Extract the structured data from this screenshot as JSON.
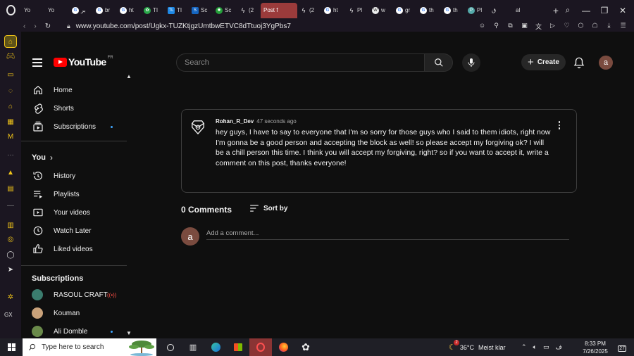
{
  "browser": {
    "tabs": [
      {
        "label": "Yo",
        "icon": "youtube-icon"
      },
      {
        "label": "Yo",
        "icon": "youtube-icon"
      },
      {
        "label": "بر",
        "icon": "google-icon"
      },
      {
        "label": "br",
        "icon": "google-icon"
      },
      {
        "label": "ht",
        "icon": "google-icon"
      },
      {
        "label": "TI",
        "icon": "openai-icon"
      },
      {
        "label": "TI",
        "icon": "tl-icon"
      },
      {
        "label": "Sc",
        "icon": "s-icon"
      },
      {
        "label": "Sc",
        "icon": "gear-icon"
      },
      {
        "label": "(2",
        "icon": "lightning-icon"
      },
      {
        "label": "Post f",
        "icon": "youtube-icon",
        "active": true
      },
      {
        "label": "(2",
        "icon": "lightning-icon"
      },
      {
        "label": "ht",
        "icon": "google-icon"
      },
      {
        "label": "Pl",
        "icon": "lightning-icon"
      },
      {
        "label": "w",
        "icon": "wiki-icon"
      },
      {
        "label": "gr",
        "icon": "google-icon"
      },
      {
        "label": "th",
        "icon": "google-icon"
      },
      {
        "label": "th",
        "icon": "google-icon"
      },
      {
        "label": "Pl",
        "icon": "pl-icon"
      },
      {
        "label": "ق",
        "icon": "youtube-icon"
      },
      {
        "label": "al",
        "icon": "youtube-icon"
      }
    ],
    "url": "www.youtube.com/post/Ugkx-TUZKtjgzUmtbwETVC8dTtuoj3YgPbs7"
  },
  "header": {
    "logo_text": "YouTube",
    "country_code": "FR",
    "search_placeholder": "Search",
    "create_label": "Create",
    "avatar_letter": "a"
  },
  "guide": {
    "main": [
      {
        "label": "Home",
        "icon": "home-icon"
      },
      {
        "label": "Shorts",
        "icon": "shorts-icon"
      },
      {
        "label": "Subscriptions",
        "icon": "subscriptions-icon",
        "dot": true
      }
    ],
    "you_heading": "You",
    "you": [
      {
        "label": "History",
        "icon": "history-icon"
      },
      {
        "label": "Playlists",
        "icon": "playlists-icon"
      },
      {
        "label": "Your videos",
        "icon": "your-videos-icon"
      },
      {
        "label": "Watch Later",
        "icon": "clock-icon"
      },
      {
        "label": "Liked videos",
        "icon": "thumbs-up-icon"
      }
    ],
    "subscriptions_heading": "Subscriptions",
    "subscriptions": [
      {
        "label": "RASOUL CRAFT",
        "live": true,
        "color": "#3b7d6e"
      },
      {
        "label": "Kouman",
        "live": false,
        "color": "#c9a27a"
      },
      {
        "label": "Ali Domble",
        "live": false,
        "color": "#6a8a4a",
        "dot": true
      }
    ]
  },
  "post": {
    "author": "Rohan_R_Dev",
    "time": "47 seconds ago",
    "text": "hey guys, I have to say to everyone that I'm so sorry for those guys who I said to them idiots, right now I'm gonna be a good person and accepting the block as well! so please accept my forgiving ok? I will be a chill person this time. I think you will accept my forgiving, right? so if you want to accept it, write a comment on this post, thanks everyone!"
  },
  "comments": {
    "count_label": "0 Comments",
    "sort_label": "Sort by",
    "add_placeholder": "Add a comment...",
    "avatar_letter": "a"
  },
  "taskbar": {
    "search_placeholder": "Type here to search",
    "weather_temp": "36°C",
    "weather_text": "Meist klar",
    "weather_badge": "2",
    "language": "ف",
    "time": "8:33 PM",
    "date": "7/26/2025",
    "notifications": "27"
  },
  "colors": {
    "youtube_red": "#ff0000",
    "accent_blue": "#3ea6ff",
    "opera_yellow": "#f0c419"
  }
}
